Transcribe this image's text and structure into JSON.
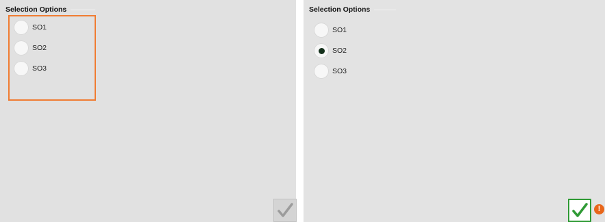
{
  "left_panel": {
    "group_title": "Selection Options",
    "options": [
      {
        "label": "SO1",
        "selected": false
      },
      {
        "label": "SO2",
        "selected": false
      },
      {
        "label": "SO3",
        "selected": false
      }
    ],
    "focused": true,
    "confirm_enabled": false
  },
  "right_panel": {
    "group_title": "Selection Options",
    "options": [
      {
        "label": "SO1",
        "selected": false
      },
      {
        "label": "SO2",
        "selected": true
      },
      {
        "label": "SO3",
        "selected": false
      }
    ],
    "confirm_enabled": true,
    "alert_symbol": "!"
  },
  "icons": {
    "confirm": "checkmark-icon",
    "alert": "exclamation-icon"
  },
  "colors": {
    "focus_border": "#f07c32",
    "check_active": "#2f9a35",
    "check_disabled": "#9c9c9c",
    "alert": "#e8661b",
    "radio_dot": "#14301b"
  }
}
